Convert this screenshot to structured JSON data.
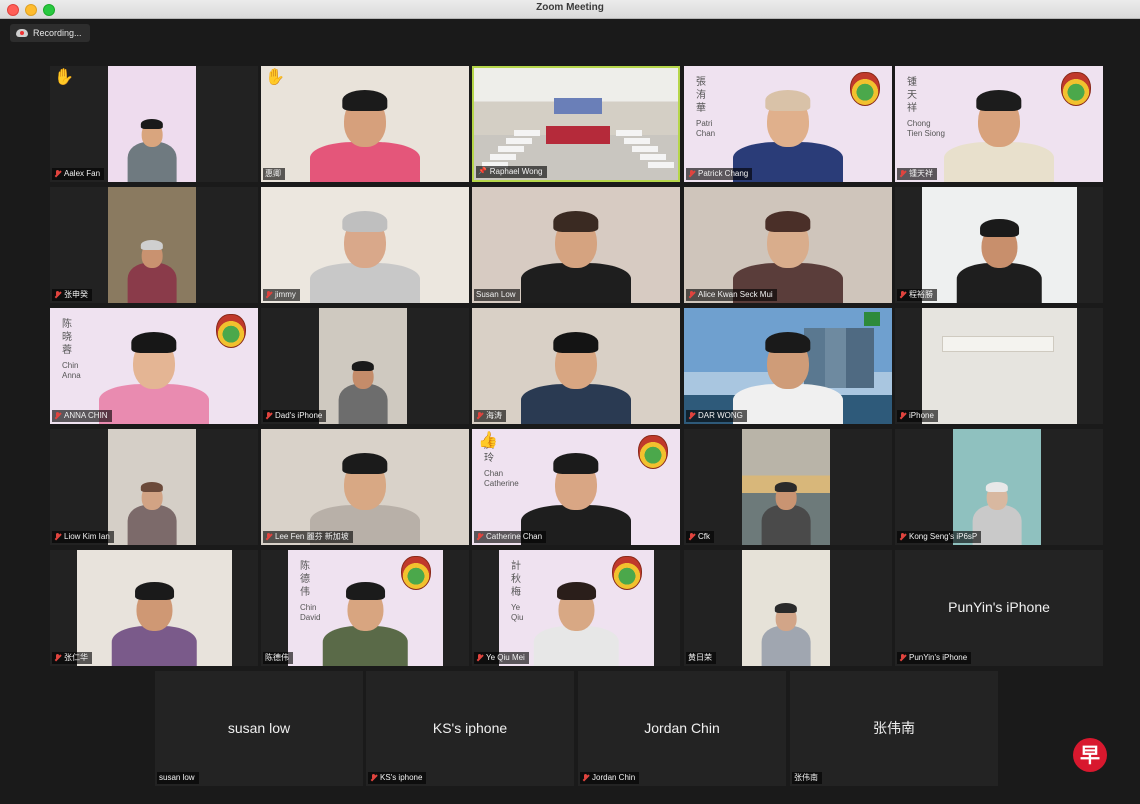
{
  "window": {
    "title": "Zoom Meeting"
  },
  "recording": {
    "label": "Recording..."
  },
  "colors": {
    "active_speaker_border": "#b6d64a",
    "muted_mic": "#e0443e",
    "logo_red": "#d8182e"
  },
  "participants": [
    {
      "name": "Aalex Fan",
      "muted": true,
      "hand_raised": true
    },
    {
      "name": "惠卿",
      "muted": false,
      "hand_raised": true
    },
    {
      "name": "Raphael Wong",
      "muted": false,
      "pinned": true,
      "active": true
    },
    {
      "name": "Patrick Chang",
      "muted": true,
      "sign_lines": [
        "張",
        "洧",
        "華"
      ],
      "sign_en": [
        "Patri",
        "Chan"
      ]
    },
    {
      "name": "锺天祥",
      "muted": true,
      "sign_lines": [
        "锺",
        "天",
        "祥"
      ],
      "sign_en": [
        "Chong",
        "Tien Siong"
      ]
    },
    {
      "name": "张申癸",
      "muted": true
    },
    {
      "name": "jimmy",
      "muted": true
    },
    {
      "name": "Susan Low",
      "muted": false
    },
    {
      "name": "Alice Kwan Seck Mui",
      "muted": true
    },
    {
      "name": "程裕勝",
      "muted": true
    },
    {
      "name": "ANNA CHIN",
      "muted": true,
      "sign_lines": [
        "陈",
        "晓",
        "蓉"
      ],
      "sign_en": [
        "Chin",
        "Anna"
      ]
    },
    {
      "name": "Dad's iPhone",
      "muted": true
    },
    {
      "name": "海涛",
      "muted": true
    },
    {
      "name": "DAR WONG",
      "muted": true
    },
    {
      "name": "iPhone",
      "muted": true
    },
    {
      "name": "Liow Kim Ian",
      "muted": true
    },
    {
      "name": "Lee Fen 麗芬 新加坡",
      "muted": true
    },
    {
      "name": "Catherine Chan",
      "muted": true,
      "sign_lines": [
        "庆",
        "玲"
      ],
      "sign_en": [
        "Chan",
        "Catherine"
      ],
      "thumbs_up": true
    },
    {
      "name": "Cfk",
      "muted": true
    },
    {
      "name": "Kong Seng's iP6sP",
      "muted": true
    },
    {
      "name": "张仁华",
      "muted": true
    },
    {
      "name": "陈德伟",
      "muted": false,
      "sign_lines": [
        "陈",
        "德",
        "伟"
      ],
      "sign_en": [
        "Chin",
        "David"
      ]
    },
    {
      "name": "Ye Qiu Mei",
      "muted": true,
      "sign_lines": [
        "計",
        "秋",
        "梅"
      ],
      "sign_en": [
        "Ye",
        "Qiu"
      ]
    },
    {
      "name": "黄日荣",
      "muted": false
    },
    {
      "name": "PunYin's iPhone",
      "muted": true,
      "video_off": true,
      "display_name": "PunYin's iPhone"
    },
    {
      "name": "susan low",
      "muted": false,
      "video_off": true,
      "display_name": "susan low"
    },
    {
      "name": "KS's iphone",
      "muted": true,
      "video_off": true,
      "display_name": "KS's iphone"
    },
    {
      "name": "Jordan Chin",
      "muted": true,
      "video_off": true,
      "display_name": "Jordan Chin"
    },
    {
      "name": "张伟南",
      "muted": false,
      "video_off": true,
      "display_name": "张伟南"
    }
  ],
  "watermark": {
    "glyph": "早"
  }
}
